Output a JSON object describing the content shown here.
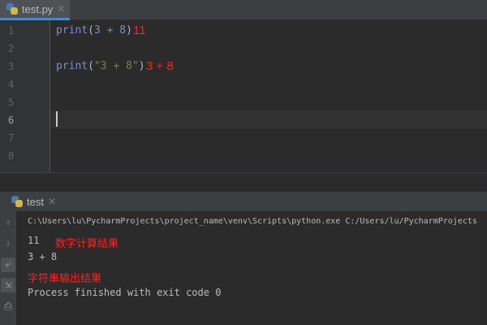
{
  "tab": {
    "filename": "test.py",
    "close": "✕"
  },
  "editor": {
    "line_numbers": [
      "1",
      "2",
      "3",
      "4",
      "5",
      "6",
      "7",
      "8"
    ],
    "lines": [
      {
        "fn": "print",
        "open": "(",
        "arg": "3 + 8",
        "close": ")"
      },
      {
        "fn": "print",
        "open": "(",
        "arg": "\"3 + 8\"",
        "close": ")"
      }
    ],
    "annotations": [
      "11",
      "3 + 8"
    ]
  },
  "run": {
    "tab_label": "test",
    "close": "✕",
    "command": "C:\\Users\\lu\\PycharmProjects\\project_name\\venv\\Scripts\\python.exe C:/Users/lu/PycharmProjects",
    "output": [
      "11",
      "3 + 8",
      "Process finished with exit code 0"
    ],
    "annotations": [
      "数字计算结果",
      "字符串输出结果"
    ],
    "toolbar": [
      "↑",
      "↓",
      "⤶",
      "⇲",
      "⎙"
    ]
  }
}
